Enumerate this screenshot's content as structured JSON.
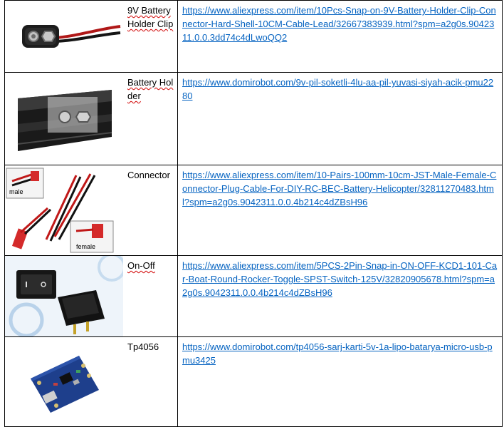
{
  "rows": [
    {
      "name": "9V Battery Holder Clip",
      "link": "https://www.aliexpress.com/item/10Pcs-Snap-on-9V-Battery-Holder-Clip-Connector-Hard-Shell-10CM-Cable-Lead/32667383939.html?spm=a2g0s.9042311.0.0.3dd74c4dLwoQQ2",
      "image": "9v-battery-clip-photo"
    },
    {
      "name": "Battery Holder",
      "link": "https://www.domirobot.com/9v-pil-soketli-4lu-aa-pil-yuvasi-siyah-acik-pmu2280",
      "image": "battery-holder-photo"
    },
    {
      "name": "Connector",
      "link": "https://www.aliexpress.com/item/10-Pairs-100mm-10cm-JST-Male-Female-Connector-Plug-Cable-For-DIY-RC-BEC-Battery-Helicopter/32811270483.html?spm=a2g0s.9042311.0.0.4b214c4dZBsH96",
      "image": "jst-connector-photo",
      "image_labels": {
        "male": "male",
        "female": "female"
      }
    },
    {
      "name": "On-Off",
      "link": "https://www.aliexpress.com/item/5PCS-2Pin-Snap-in-ON-OFF-KCD1-101-Car-Boat-Round-Rocker-Toggle-SPST-Switch-125V/32820905678.html?spm=a2g0s.9042311.0.0.4b214c4dZBsH96",
      "image": "rocker-switch-photo"
    },
    {
      "name": "Tp4056",
      "link": "https://www.domirobot.com/tp4056-sarj-karti-5v-1a-lipo-batarya-micro-usb-pmu3425",
      "image": "tp4056-module-photo"
    }
  ],
  "colors": {
    "link": "#0563c1",
    "spellcheck": "#d00000",
    "border": "#000000"
  }
}
